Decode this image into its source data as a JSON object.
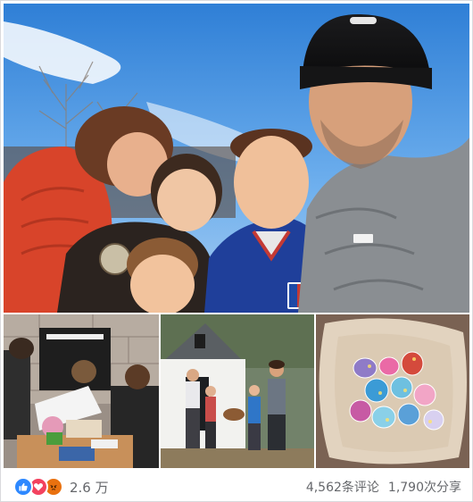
{
  "post": {
    "photos": [
      {
        "subject": "family selfie outdoors at sunset"
      },
      {
        "subject": "boy painting easter eggs at table"
      },
      {
        "subject": "family with baskets outside white house"
      },
      {
        "subject": "painted easter eggs in wooden bowl"
      }
    ]
  },
  "footer": {
    "reaction_icons": [
      "like-icon",
      "love-icon",
      "angry-icon"
    ],
    "reaction_count": "2.6 万",
    "comments": "4,562条评论",
    "shares": "1,790次分享"
  },
  "colors": {
    "like": "#2d88ff",
    "love": "#f3425f",
    "angry": "#e9710f",
    "meta_text": "#65676b"
  }
}
